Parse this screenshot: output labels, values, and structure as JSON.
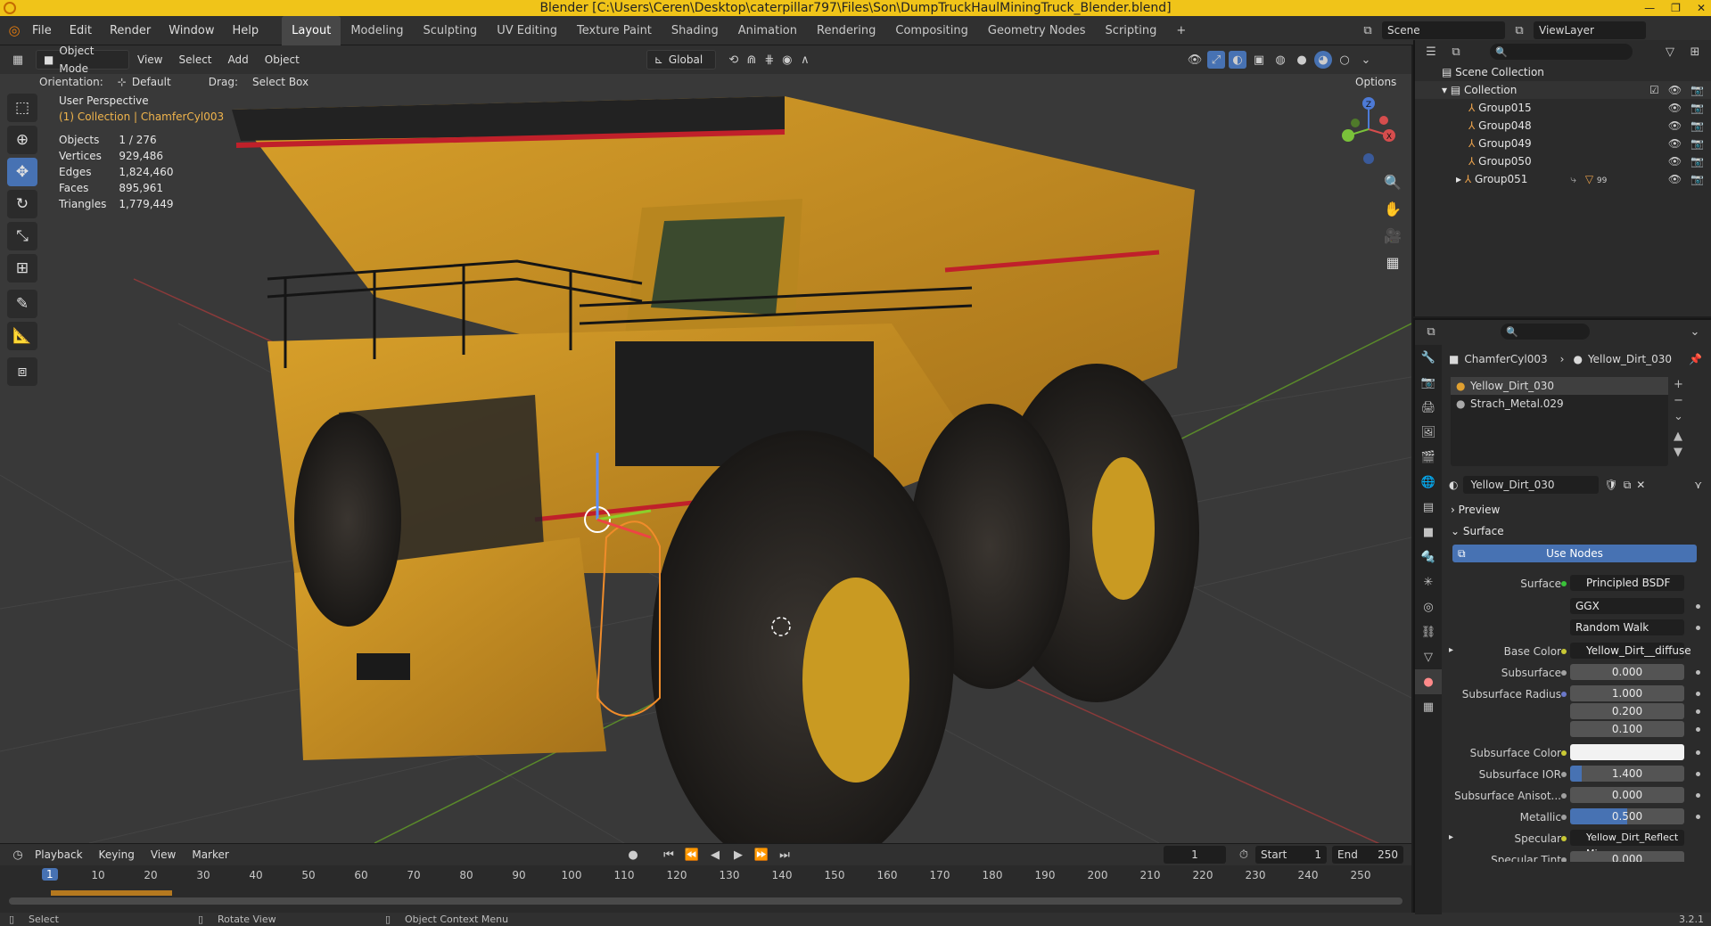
{
  "titlebar": {
    "title": "Blender [C:\\Users\\Ceren\\Desktop\\caterpillar797\\Files\\Son\\DumpTruckHaulMiningTruck_Blender.blend]",
    "min": "—",
    "max": "❐",
    "close": "✕"
  },
  "menu": {
    "file": "File",
    "edit": "Edit",
    "render": "Render",
    "window": "Window",
    "help": "Help"
  },
  "workspaces": [
    "Layout",
    "Modeling",
    "Sculpting",
    "UV Editing",
    "Texture Paint",
    "Shading",
    "Animation",
    "Rendering",
    "Compositing",
    "Geometry Nodes",
    "Scripting"
  ],
  "add_workspace": "+",
  "scene": {
    "name": "Scene",
    "viewlayer": "ViewLayer"
  },
  "vp_header": {
    "mode": "Object Mode",
    "view": "View",
    "select": "Select",
    "add": "Add",
    "object": "Object",
    "transform": "Global",
    "orientation_label": "Orientation:",
    "orientation_value": "Default",
    "drag_label": "Drag:",
    "drag_value": "Select Box",
    "options": "Options"
  },
  "stats": {
    "perspective": "User Perspective",
    "collection": "(1) Collection | ChamferCyl003",
    "rows": [
      {
        "label": "Objects",
        "value": "1 / 276"
      },
      {
        "label": "Vertices",
        "value": "929,486"
      },
      {
        "label": "Edges",
        "value": "1,824,460"
      },
      {
        "label": "Faces",
        "value": "895,961"
      },
      {
        "label": "Triangles",
        "value": "1,779,449"
      }
    ]
  },
  "gizmo": {
    "z": "Z",
    "x": "X",
    "y": "Y"
  },
  "timeline": {
    "playback": "Playback",
    "keying": "Keying",
    "view": "View",
    "marker": "Marker",
    "current": "1",
    "start_label": "Start",
    "start": "1",
    "end_label": "End",
    "end": "250",
    "current_frame_badge": "1",
    "ticks": [
      "10",
      "20",
      "30",
      "40",
      "50",
      "60",
      "70",
      "80",
      "90",
      "100",
      "110",
      "120",
      "130",
      "140",
      "150",
      "160",
      "170",
      "180",
      "190",
      "200",
      "210",
      "220",
      "230",
      "240",
      "250"
    ]
  },
  "status": {
    "select": "Select",
    "rotate": "Rotate View",
    "context": "Object Context Menu",
    "version": "3.2.1"
  },
  "outliner": {
    "root": "Scene Collection",
    "collection": "Collection",
    "items": [
      "Group015",
      "Group048",
      "Group049",
      "Group050",
      "Group051"
    ],
    "group051_badge": "99"
  },
  "properties": {
    "breadcrumb_object": "ChamferCyl003",
    "breadcrumb_material": "Yellow_Dirt_030",
    "slots": [
      "Yellow_Dirt_030",
      "Strach_Metal.029"
    ],
    "material_name": "Yellow_Dirt_030",
    "preview": "Preview",
    "surface_section": "Surface",
    "use_nodes": "Use Nodes",
    "surface_label": "Surface",
    "surface_value": "Principled BSDF",
    "distribution": "GGX",
    "subsurface_method": "Random Walk",
    "fields": [
      {
        "label": "Base Color",
        "value": "Yellow_Dirt__diffuse",
        "dot": "yellow",
        "kind": "dark"
      },
      {
        "label": "Subsurface",
        "value": "0.000",
        "dot": "grey",
        "kind": "num"
      },
      {
        "label": "Subsurface Radius",
        "value": "1.000",
        "dot": "blue",
        "kind": "num"
      },
      {
        "label": "",
        "value": "0.200",
        "dot": "",
        "kind": "num"
      },
      {
        "label": "",
        "value": "0.100",
        "dot": "",
        "kind": "num"
      },
      {
        "label": "Subsurface Color",
        "value": "",
        "dot": "yellow",
        "kind": "white"
      },
      {
        "label": "Subsurface IOR",
        "value": "1.400",
        "dot": "grey",
        "kind": "num"
      },
      {
        "label": "Subsurface Anisot...",
        "value": "0.000",
        "dot": "grey",
        "kind": "num"
      },
      {
        "label": "Metallic",
        "value": "0.500",
        "dot": "grey",
        "kind": "blue"
      },
      {
        "label": "Specular",
        "value": "Yellow_Dirt_Reflect Mix",
        "dot": "yellow",
        "kind": "dark"
      },
      {
        "label": "Specular Tint",
        "value": "0.000",
        "dot": "grey",
        "kind": "num"
      }
    ]
  }
}
